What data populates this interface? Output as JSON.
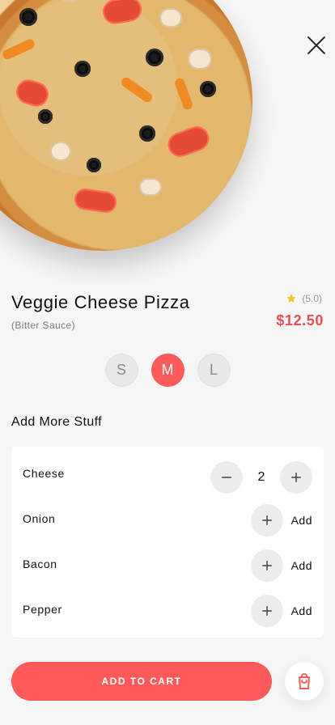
{
  "product": {
    "title": "Veggie Cheese Pizza",
    "subtitle": "(Bitter Sauce)",
    "rating_text": "(5.0)",
    "price": "$12.50"
  },
  "sizes": {
    "options": [
      "S",
      "M",
      "L"
    ],
    "selected": "M"
  },
  "add_more": {
    "title": "Add More Stuff",
    "items": [
      {
        "name": "Cheese",
        "quantity": "2",
        "action_label": ""
      },
      {
        "name": "Onion",
        "quantity": "",
        "action_label": "Add"
      },
      {
        "name": "Bacon",
        "quantity": "",
        "action_label": "Add"
      },
      {
        "name": "Pepper",
        "quantity": "",
        "action_label": "Add"
      }
    ]
  },
  "actions": {
    "add_to_cart_label": "ADD TO CART"
  },
  "icons": {
    "close": "close-icon",
    "rating": "star-icon",
    "minus": "minus-icon",
    "plus": "plus-icon",
    "cart": "shopping-bag-icon"
  },
  "colors": {
    "accent": "#ff5a5a",
    "price": "#ef4b4b",
    "star": "#f3c623"
  }
}
